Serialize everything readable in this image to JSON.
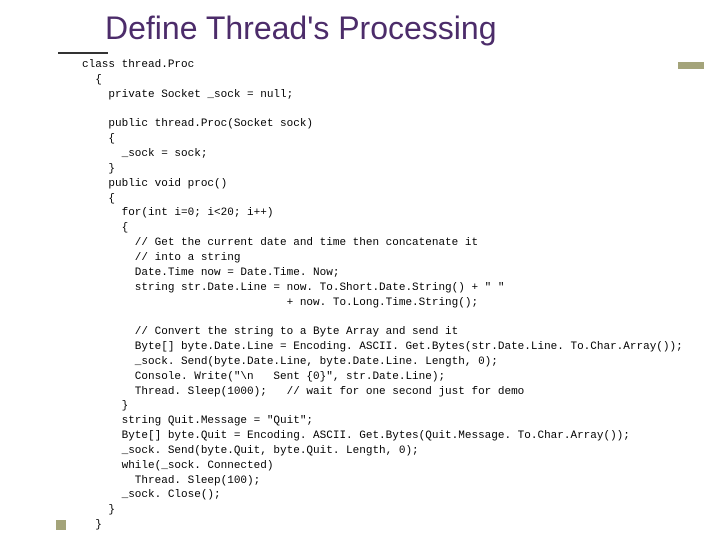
{
  "title": "Define Thread's Processing",
  "code": {
    "l01": "class thread.Proc",
    "l02": "  {",
    "l03": "    private Socket _sock = null;",
    "l04": "",
    "l05": "    public thread.Proc(Socket sock)",
    "l06": "    {",
    "l07": "      _sock = sock;",
    "l08": "    }",
    "l09": "    public void proc()",
    "l10": "    {",
    "l11": "      for(int i=0; i<20; i++)",
    "l12": "      {",
    "l13": "        // Get the current date and time then concatenate it",
    "l14": "        // into a string",
    "l15": "        Date.Time now = Date.Time. Now;",
    "l16": "        string str.Date.Line = now. To.Short.Date.String() + \" \"",
    "l17": "                               + now. To.Long.Time.String();",
    "l18": "",
    "l19": "        // Convert the string to a Byte Array and send it",
    "l20": "        Byte[] byte.Date.Line = Encoding. ASCII. Get.Bytes(str.Date.Line. To.Char.Array());",
    "l21": "        _sock. Send(byte.Date.Line, byte.Date.Line. Length, 0);",
    "l22": "        Console. Write(\"\\n   Sent {0}\", str.Date.Line);",
    "l23": "        Thread. Sleep(1000);   // wait for one second just for demo",
    "l24": "      }",
    "l25": "      string Quit.Message = \"Quit\";",
    "l26": "      Byte[] byte.Quit = Encoding. ASCII. Get.Bytes(Quit.Message. To.Char.Array());",
    "l27": "      _sock. Send(byte.Quit, byte.Quit. Length, 0);",
    "l28": "      while(_sock. Connected)",
    "l29": "        Thread. Sleep(100);",
    "l30": "      _sock. Close();",
    "l31": "    }",
    "l32": "  }"
  }
}
